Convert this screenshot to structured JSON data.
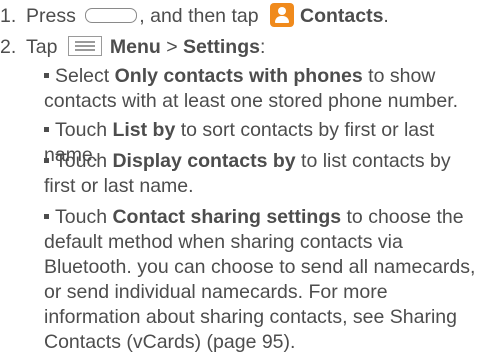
{
  "steps": [
    {
      "number": "1.",
      "before": "Press",
      "middle": ", and then tap",
      "target": "Contacts",
      "end": "."
    },
    {
      "number": "2.",
      "before": "Tap",
      "menu_label": "Menu",
      "separator": ">",
      "settings_label": "Settings",
      "end": ":"
    }
  ],
  "bullets": [
    {
      "pre": "Select",
      "term": "Only contacts with phones",
      "rest": "to show contacts with at least one stored phone number."
    },
    {
      "pre": "Touch",
      "term": "List by",
      "rest": "to sort contacts by first or last name."
    },
    {
      "pre": "Touch",
      "term": "Display contacts by",
      "rest": "to list contacts by first or last name."
    },
    {
      "pre": "Touch",
      "term": "Contact sharing settings",
      "rest": "to choose the default method when sharing contacts via Bluetooth. you can choose to send all namecards, or send individual namecards. For more information about sharing contacts, see Sharing Contacts (vCards) (page 95)."
    }
  ],
  "icons": {
    "home_key": "home-key-icon",
    "contacts": "contacts-app-icon",
    "menu": "menu-key-icon"
  },
  "colors": {
    "text": "#4d4d4d",
    "contacts_icon": "#f08a1c"
  }
}
